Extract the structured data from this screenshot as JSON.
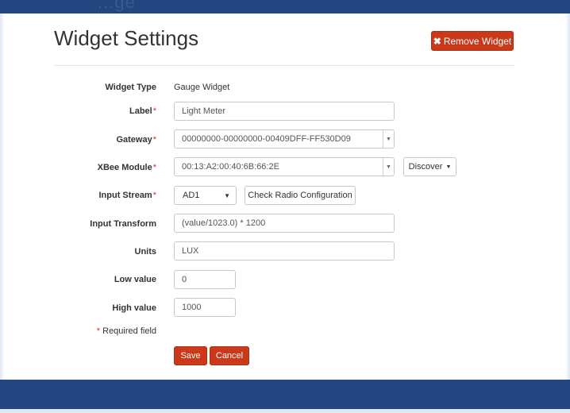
{
  "header": {
    "ghost_title": "...ge",
    "page_title": "Widget Settings",
    "remove_button": "Remove Widget"
  },
  "form": {
    "widget_type": {
      "label": "Widget Type",
      "value": "Gauge Widget"
    },
    "label": {
      "label": "Label",
      "value": "Light Meter",
      "required": true
    },
    "gateway": {
      "label": "Gateway",
      "value": "00000000-00000000-00409DFF-FF530D09",
      "required": true
    },
    "xbee_module": {
      "label": "XBee Module",
      "value": "00:13:A2:00:40:6B:66:2E",
      "required": true,
      "discover_label": "Discover"
    },
    "input_stream": {
      "label": "Input Stream",
      "value": "AD1",
      "required": true,
      "check_button": "Check Radio Configuration"
    },
    "input_transform": {
      "label": "Input Transform",
      "value": "(value/1023.0) * 1200"
    },
    "units": {
      "label": "Units",
      "value": "LUX"
    },
    "low_value": {
      "label": "Low value",
      "value": "0"
    },
    "high_value": {
      "label": "High value",
      "value": "1000"
    },
    "required_note": "Required field",
    "required_marker": "*",
    "save_button": "Save",
    "cancel_button": "Cancel"
  },
  "colors": {
    "brand_bar": "#24457f",
    "danger": "#c9391a"
  },
  "icons": {
    "remove": "close-icon",
    "dropdown": "caret-down-icon"
  }
}
